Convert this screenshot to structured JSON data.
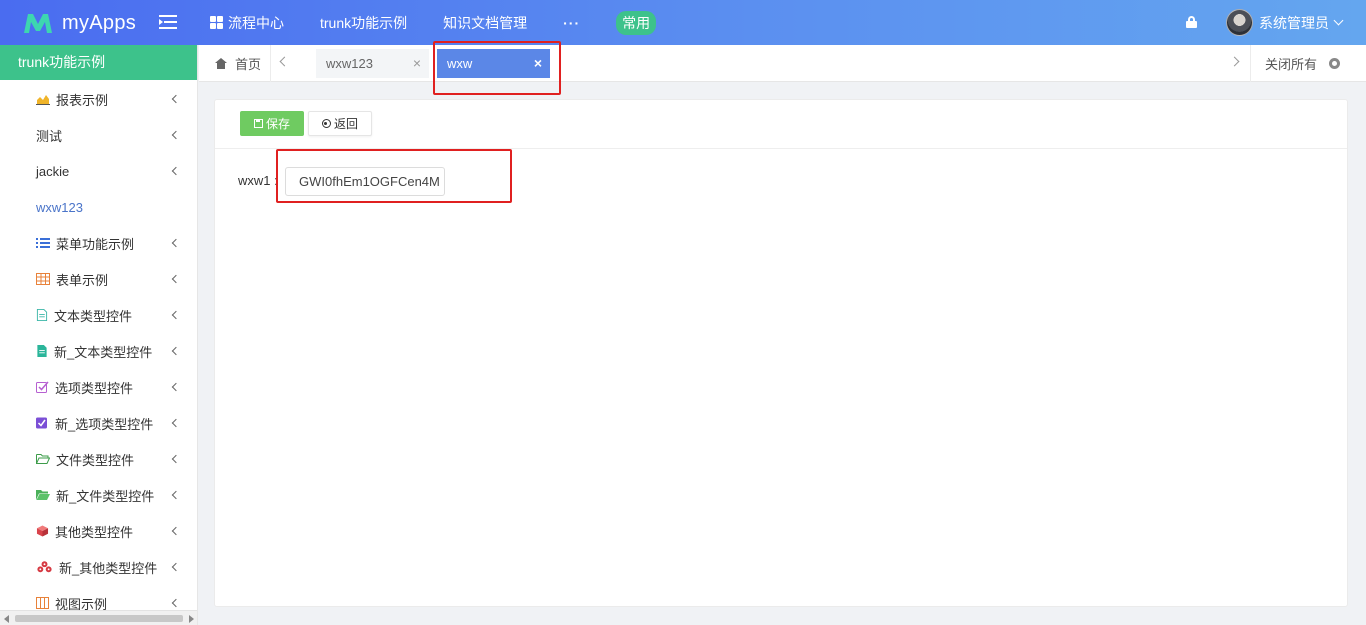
{
  "app": {
    "logo_text": "myApps"
  },
  "topnav": {
    "items": [
      {
        "label": "流程中心",
        "icon": "grid-icon"
      },
      {
        "label": "trunk功能示例"
      },
      {
        "label": "知识文档管理"
      }
    ],
    "more": "···",
    "badge": "常用"
  },
  "user": {
    "name": "系统管理员"
  },
  "sidebar": {
    "header": "trunk功能示例",
    "items": [
      {
        "label": "报表示例",
        "icon": "area-chart-icon",
        "has_arrow": true
      },
      {
        "label": "测试",
        "icon": "",
        "has_arrow": true
      },
      {
        "label": "jackie",
        "icon": "",
        "has_arrow": true
      },
      {
        "label": "wxw123",
        "icon": "",
        "has_arrow": false,
        "active": true
      },
      {
        "label": "菜单功能示例",
        "icon": "list-icon",
        "has_arrow": true
      },
      {
        "label": "表单示例",
        "icon": "table-icon",
        "has_arrow": true
      },
      {
        "label": "文本类型控件",
        "icon": "file-text-icon",
        "has_arrow": true
      },
      {
        "label": "新_文本类型控件",
        "icon": "file-filled-icon",
        "has_arrow": true
      },
      {
        "label": "选项类型控件",
        "icon": "checkbox-icon",
        "has_arrow": true
      },
      {
        "label": "新_选项类型控件",
        "icon": "checkbox-filled-icon",
        "has_arrow": true
      },
      {
        "label": "文件类型控件",
        "icon": "folder-open-icon",
        "has_arrow": true
      },
      {
        "label": "新_文件类型控件",
        "icon": "folder-filled-icon",
        "has_arrow": true
      },
      {
        "label": "其他类型控件",
        "icon": "cube-icon",
        "has_arrow": true
      },
      {
        "label": "新_其他类型控件",
        "icon": "cubes-icon",
        "has_arrow": true
      },
      {
        "label": "视图示例",
        "icon": "columns-icon",
        "has_arrow": true
      }
    ]
  },
  "tabs": {
    "home": "首页",
    "items": [
      {
        "label": "wxw123",
        "close": "×",
        "active": false
      },
      {
        "label": "wxw",
        "close": "×",
        "active": true
      }
    ],
    "close_all": "关闭所有"
  },
  "form": {
    "save_label": "保存",
    "back_label": "返回",
    "field_label": "wxw1 :",
    "field_value": "GWI0fhEm1OGFCen4M"
  },
  "colors": {
    "accent_green": "#3dc28b",
    "tab_active": "#5b87e7",
    "save_button": "#6fcb61",
    "highlight_red": "#e02020"
  }
}
